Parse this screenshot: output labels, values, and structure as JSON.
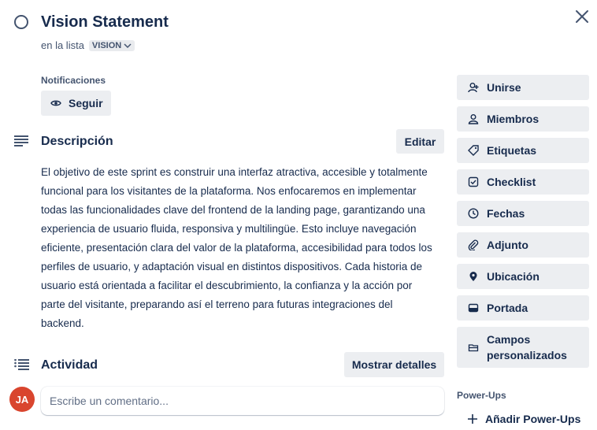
{
  "card": {
    "title": "Vision Statement",
    "list_prefix": "en la lista",
    "list_name": "VISION"
  },
  "notifications": {
    "label": "Notificaciones",
    "follow_label": "Seguir"
  },
  "description": {
    "heading": "Descripción",
    "edit_label": "Editar",
    "text": "El objetivo de este sprint es construir una interfaz atractiva, accesible y totalmente funcional para los visitantes de la plataforma. Nos enfocaremos en implementar todas las funcionalidades clave del frontend de la landing page, garantizando una experiencia de usuario fluida, responsiva y multilingüe. Esto incluye navegación eficiente, presentación clara del valor de la plataforma, accesibilidad para todos los perfiles de usuario, y adaptación visual en distintos dispositivos. Cada historia de usuario está orientada a facilitar el descubrimiento, la confianza y la acción por parte del visitante, preparando así el terreno para futuras integraciones del backend."
  },
  "activity": {
    "heading": "Actividad",
    "show_details_label": "Mostrar detalles",
    "avatar_initials": "JA",
    "comment_placeholder": "Escribe un comentario..."
  },
  "sidebar": {
    "items": [
      {
        "label": "Unirse",
        "icon": "person-add-icon"
      },
      {
        "label": "Miembros",
        "icon": "person-icon"
      },
      {
        "label": "Etiquetas",
        "icon": "tag-icon"
      },
      {
        "label": "Checklist",
        "icon": "checkbox-icon"
      },
      {
        "label": "Fechas",
        "icon": "clock-icon"
      },
      {
        "label": "Adjunto",
        "icon": "paperclip-icon"
      },
      {
        "label": "Ubicación",
        "icon": "location-pin-icon"
      },
      {
        "label": "Portada",
        "icon": "cover-icon"
      },
      {
        "label": "Campos personalizados",
        "icon": "custom-fields-icon"
      }
    ],
    "powerups_label": "Power-Ups",
    "add_powerups_label": "Añadir Power-Ups"
  },
  "colors": {
    "text": "#172b4d",
    "subtle_text": "#44546f",
    "button_bg": "#eceef1",
    "avatar_bg": "#d9452e"
  }
}
